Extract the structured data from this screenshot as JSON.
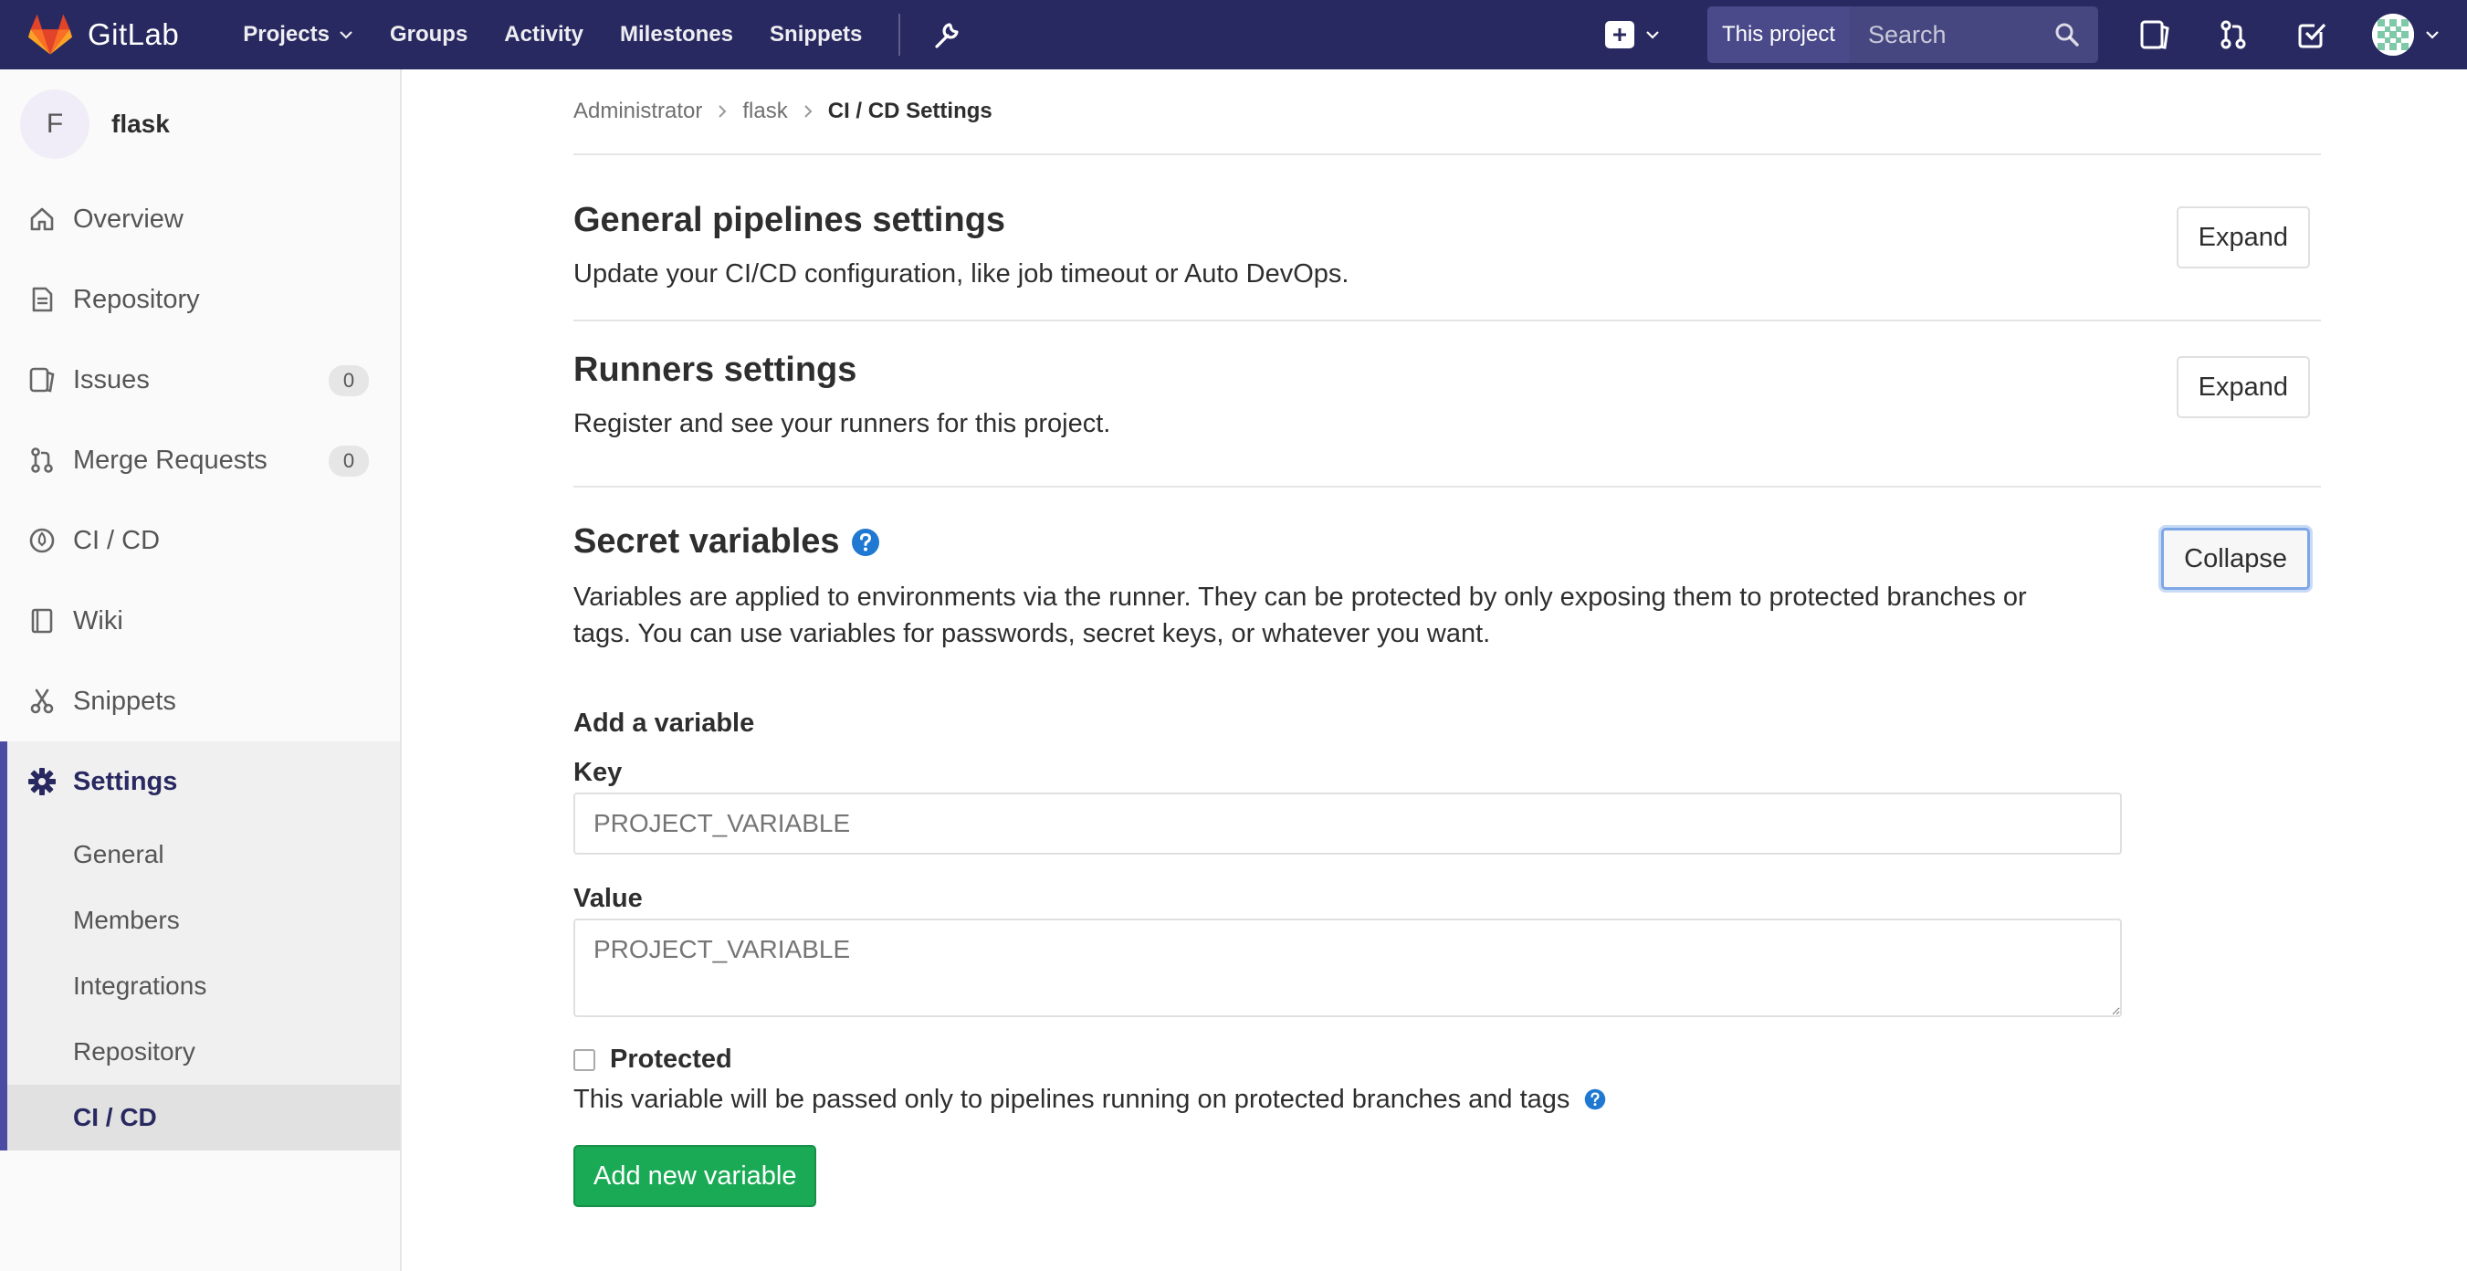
{
  "navbar": {
    "brand": "GitLab",
    "links": [
      "Projects",
      "Groups",
      "Activity",
      "Milestones",
      "Snippets"
    ],
    "scope": "This project",
    "search_placeholder": "Search",
    "bg_color": "#292961"
  },
  "sidebar": {
    "project_initial": "F",
    "project_name": "flask",
    "items": [
      {
        "label": "Overview",
        "icon": "home-icon"
      },
      {
        "label": "Repository",
        "icon": "doc-icon"
      },
      {
        "label": "Issues",
        "icon": "issues-icon",
        "badge": "0"
      },
      {
        "label": "Merge Requests",
        "icon": "merge-request-icon",
        "badge": "0"
      },
      {
        "label": "CI / CD",
        "icon": "rocket-icon"
      },
      {
        "label": "Wiki",
        "icon": "book-icon"
      },
      {
        "label": "Snippets",
        "icon": "scissors-icon"
      }
    ],
    "settings": {
      "label": "Settings",
      "icon": "gear-icon",
      "sub_items": [
        "General",
        "Members",
        "Integrations",
        "Repository",
        "CI / CD"
      ],
      "active_sub": "CI / CD"
    }
  },
  "breadcrumb": [
    "Administrator",
    "flask",
    "CI / CD Settings"
  ],
  "sections": {
    "general": {
      "title": "General pipelines settings",
      "desc": "Update your CI/CD configuration, like job timeout or Auto DevOps.",
      "button": "Expand"
    },
    "runners": {
      "title": "Runners settings",
      "desc": "Register and see your runners for this project.",
      "button": "Expand"
    },
    "secret": {
      "title": "Secret variables",
      "desc_line1": "Variables are applied to environments via the runner. They can be protected by only exposing them to protected branches or",
      "desc_line2": "tags. You can use variables for passwords, secret keys, or whatever you want.",
      "button": "Collapse"
    }
  },
  "form": {
    "heading": "Add a variable",
    "key_label": "Key",
    "key_placeholder": "PROJECT_VARIABLE",
    "value_label": "Value",
    "value_placeholder": "PROJECT_VARIABLE",
    "protected_label": "Protected",
    "protected_checked": false,
    "protected_help": "This variable will be passed only to pipelines running on protected branches and tags",
    "submit": "Add new variable",
    "submit_color": "#1aaa55"
  }
}
